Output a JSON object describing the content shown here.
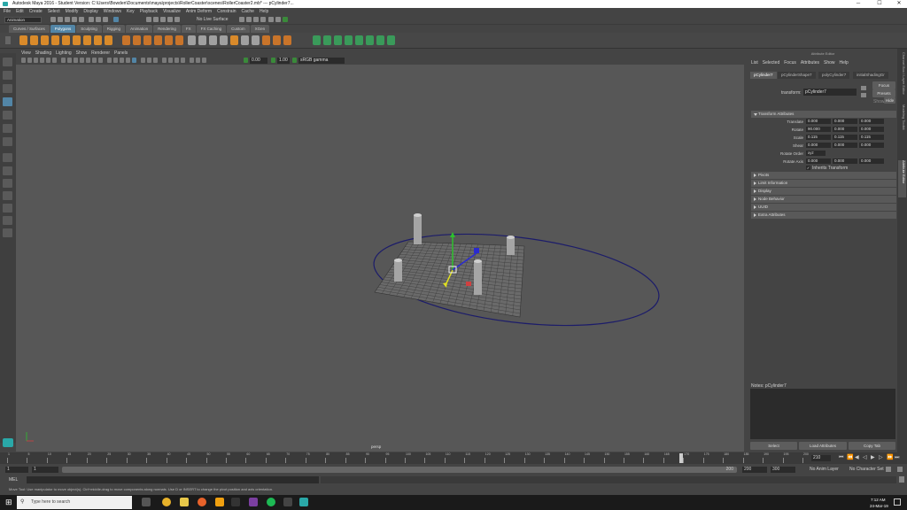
{
  "title": "Autodesk Maya 2016 - Student Version: C:\\Users\\Bowden\\Documents\\maya\\projects\\RollerCoaster\\scenes\\RollerCoaster2.mb* --- pCylinder7...",
  "menubar": [
    "File",
    "Edit",
    "Create",
    "Select",
    "Modify",
    "Display",
    "Windows",
    "Key",
    "Playback",
    "Visualize",
    "Anim Deform",
    "Constrain",
    "Cache",
    "Help"
  ],
  "status": {
    "mode": "Animation",
    "live_surface": "No Live Surface"
  },
  "shelf_tabs": [
    "Curves / Surfaces",
    "Polygons",
    "Sculpting",
    "Rigging",
    "Animation",
    "Rendering",
    "FX",
    "FX Caching",
    "Custom",
    "XGen"
  ],
  "shelf_active": "Polygons",
  "viewport_menu": [
    "View",
    "Shading",
    "Lighting",
    "Show",
    "Renderer",
    "Panels"
  ],
  "viewport_fields": {
    "near": "0.00",
    "far": "1.00",
    "color_space": "sRGB gamma"
  },
  "viewport_label": "persp",
  "attribute_editor": {
    "title": "Attribute Editor",
    "menu": [
      "List",
      "Selected",
      "Focus",
      "Attributes",
      "Show",
      "Help"
    ],
    "tabs": [
      "pCylinder7",
      "pCylinderShape7",
      "polyCylinder7",
      "initialShadingGr"
    ],
    "transform_label": "transform:",
    "transform_value": "pCylinder7",
    "focus": "Focus",
    "presets": "Presets",
    "show": "Show",
    "hide": "Hide",
    "section_transform": "Transform Attributes",
    "translate": {
      "label": "Translate",
      "values": [
        "0.000",
        "0.000",
        "0.000"
      ]
    },
    "rotate": {
      "label": "Rotate",
      "values": [
        "90.000",
        "0.000",
        "0.000"
      ]
    },
    "scale": {
      "label": "Scale",
      "values": [
        "0.115",
        "0.115",
        "0.115"
      ]
    },
    "shear": {
      "label": "Shear",
      "values": [
        "0.000",
        "0.000",
        "0.000"
      ]
    },
    "rotate_order": {
      "label": "Rotate Order",
      "value": "xyz"
    },
    "rotate_axis": {
      "label": "Rotate Axis",
      "values": [
        "0.000",
        "0.000",
        "0.000"
      ]
    },
    "inherits": "Inherits Transform",
    "sections": [
      "Pivots",
      "Limit Information",
      "Display",
      "Node Behavior",
      "UUID",
      "Extra Attributes"
    ],
    "notes": "Notes: pCylinder7",
    "buttons": [
      "Select",
      "Load Attributes",
      "Copy Tab"
    ]
  },
  "side_tabs": [
    "Channel Box / Layer Editor",
    "Modeling Toolkit",
    "Attribute Editor"
  ],
  "timeline": {
    "ticks": [
      "1",
      "5",
      "10",
      "15",
      "20",
      "25",
      "30",
      "35",
      "40",
      "45",
      "50",
      "55",
      "60",
      "65",
      "70",
      "75",
      "80",
      "85",
      "90",
      "95",
      "100",
      "105",
      "110",
      "115",
      "120",
      "125",
      "130",
      "135",
      "140",
      "145",
      "150",
      "155",
      "160",
      "165",
      "170",
      "175",
      "180",
      "185",
      "190",
      "195",
      "200"
    ],
    "current": "210",
    "range": {
      "start": "1",
      "start2": "1",
      "inner_end": "200",
      "end": "200",
      "outer_end": "300"
    },
    "anim_layer": "No Anim Layer",
    "char_set": "No Character Set"
  },
  "cmd": {
    "label": "MEL"
  },
  "help_line": "Move Tool: Use manipulator to move object(s). Ctrl+middle-drag to move components along normals. Use D or INSERT to change the pivot position and axis orientation.",
  "taskbar": {
    "search": "Type here to search",
    "time": "7:12 AM",
    "date": "24-Mar-19"
  }
}
